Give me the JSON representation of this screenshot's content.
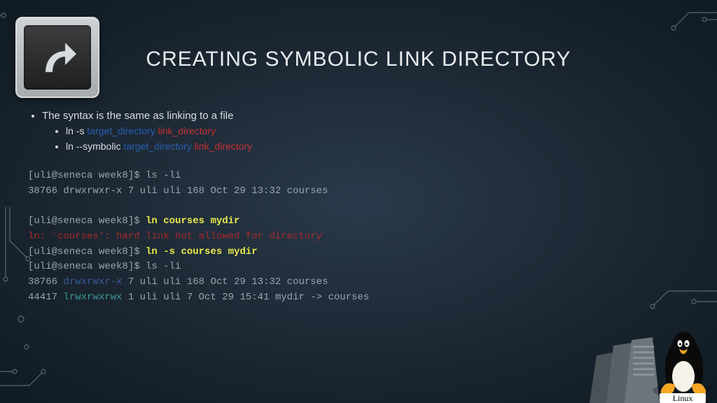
{
  "title": "CREATING SYMBOLIC LINK DIRECTORY",
  "bullet1": "The syntax is the same as linking to a file",
  "syntax1": {
    "cmd": "ln -s ",
    "target": "target_directory",
    "link": " link_directory"
  },
  "syntax2": {
    "cmd": "ln --symbolic ",
    "target": "target_directory",
    "link": " link_directory"
  },
  "term": {
    "p1a": "[uli@seneca week8]$ ls -li",
    "p1b": "38766 drwxrwxr-x 7 uli uli  168 Oct 29 13:32 courses",
    "p2a_prompt": "[uli@seneca week8]$ ",
    "p2a_cmd": "ln courses mydir",
    "err": "ln: `courses': hard link not allowed for directory",
    "p3a_prompt": "[uli@seneca week8]$ ",
    "p3a_cmd": "ln -s courses mydir",
    "p4": "[uli@seneca week8]$ ls -li",
    "p5a": "38766 ",
    "p5_perm": "drwxrwxr-x",
    "p5b": " 7 uli uli 168 Oct 29 13:32 courses",
    "p6a": "44417 ",
    "p6_perm": "lrwxrwxrwx",
    "p6b": " 1 uli uli   7 Oct 29 15:41 mydir -> courses"
  },
  "linux_label": "Linux"
}
